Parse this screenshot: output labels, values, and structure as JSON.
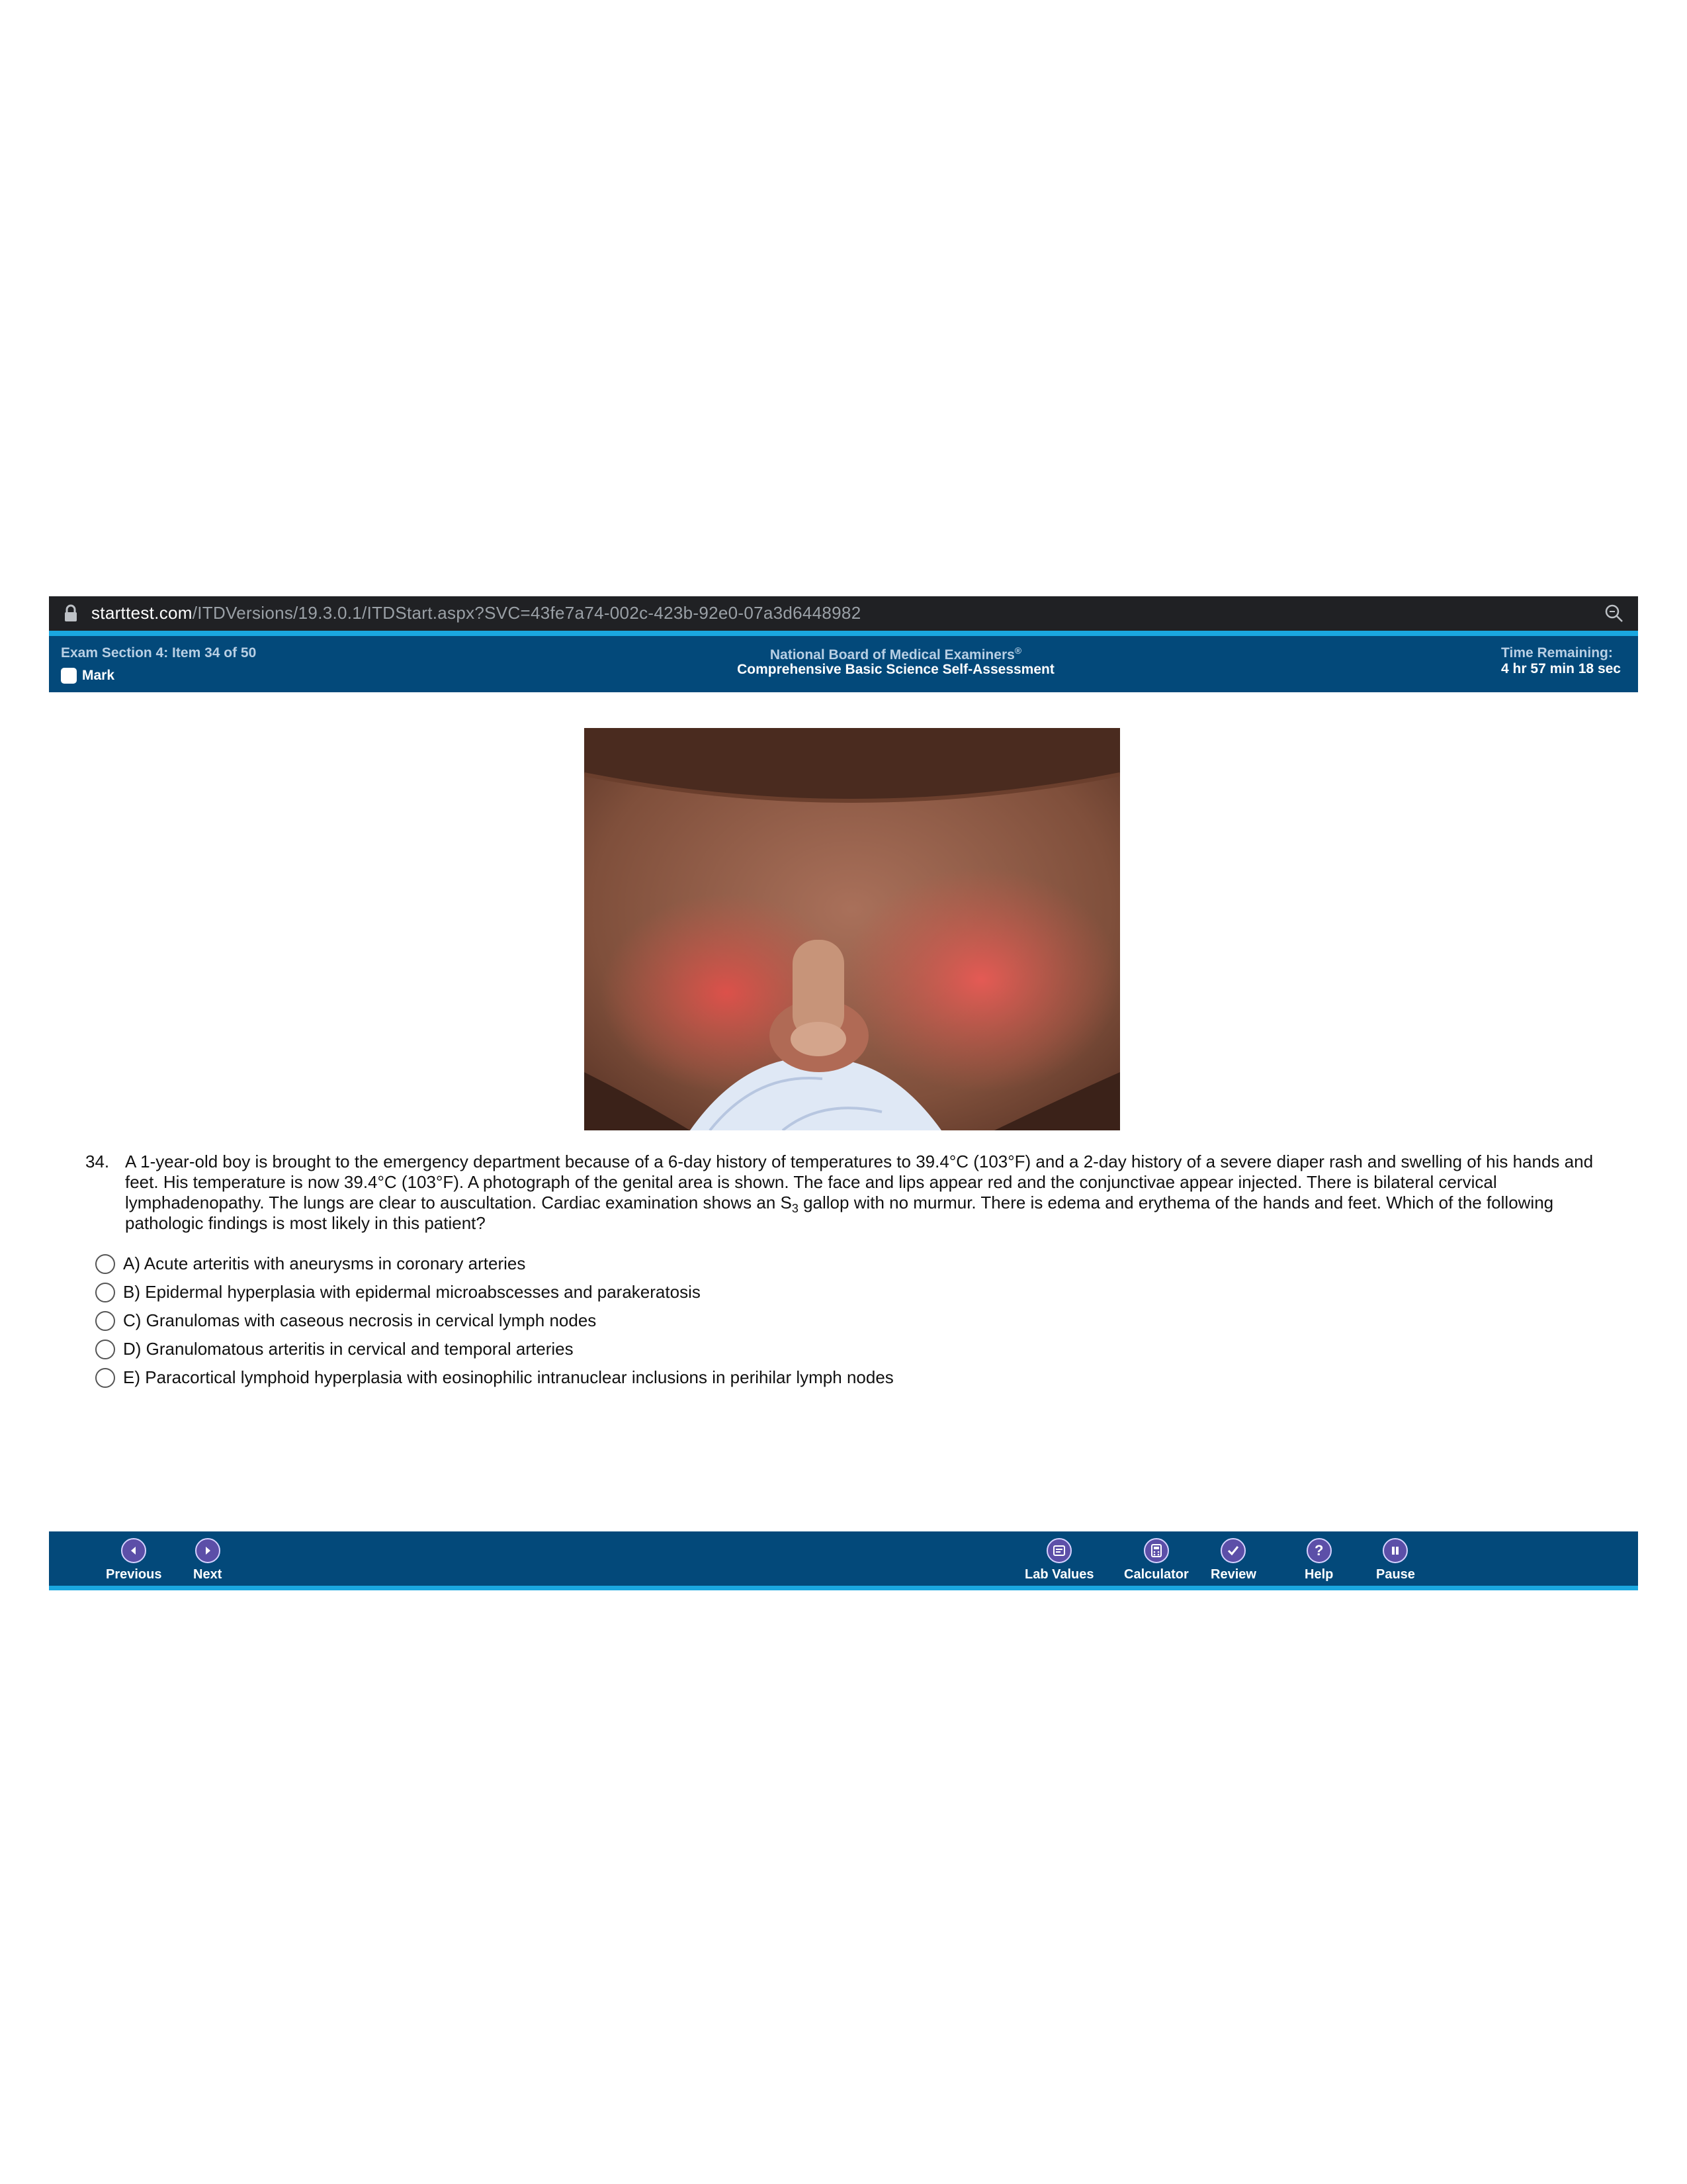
{
  "browser": {
    "url_host": "starttest.com",
    "url_path": "/ITDVersions/19.3.0.1/ITDStart.aspx?SVC=43fe7a74-002c-423b-92e0-07a3d6448982"
  },
  "header": {
    "item_label": "Exam Section 4: Item 34 of 50",
    "mark_label": "Mark",
    "org": "National Board of Medical Examiners",
    "org_mark": "®",
    "exam_name": "Comprehensive Basic Science Self-Assessment",
    "time_label": "Time Remaining:",
    "time_value": "4 hr 57 min 18 sec"
  },
  "question": {
    "number": "34.",
    "text_part1": "A 1-year-old boy is brought to the emergency department because of a 6-day history of temperatures to 39.4°C (103°F) and a 2-day history of a severe diaper rash and swelling of his hands and feet. His temperature is now 39.4°C (103°F). A photograph of the genital area is shown. The face and lips appear red and the conjunctivae appear injected. There is bilateral cervical lymphadenopathy. The lungs are clear to auscultation. Cardiac examination shows an S",
    "text_sub": "3",
    "text_part2": " gallop with no murmur. There is edema and erythema of the hands and feet. Which of the following pathologic findings is most likely in this patient?",
    "options": [
      "A) Acute arteritis with aneurysms in coronary arteries",
      "B) Epidermal hyperplasia with epidermal microabscesses and parakeratosis",
      "C) Granulomas with caseous necrosis in cervical lymph nodes",
      "D) Granulomatous arteritis in cervical and temporal arteries",
      "E) Paracortical lymphoid hyperplasia with eosinophilic intranuclear inclusions in perihilar lymph nodes"
    ]
  },
  "footer": {
    "previous": "Previous",
    "next": "Next",
    "lab_values": "Lab Values",
    "calculator": "Calculator",
    "review": "Review",
    "help": "Help",
    "help_icon_glyph": "?",
    "pause": "Pause"
  },
  "colors": {
    "header_bg": "#03497a",
    "accent_strip": "#1aa7e0",
    "icon_bg": "#5c4fa8"
  }
}
